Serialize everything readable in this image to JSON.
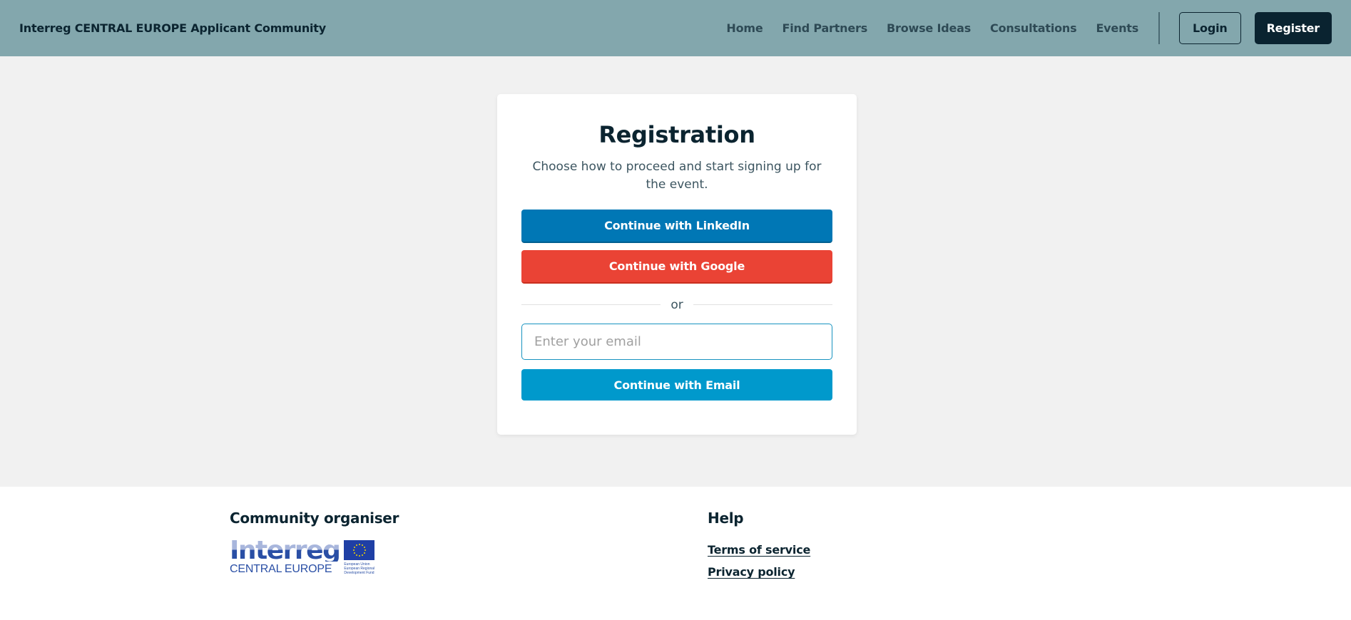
{
  "header": {
    "brand": "Interreg CENTRAL EUROPE Applicant Community",
    "nav": [
      {
        "label": "Home"
      },
      {
        "label": "Find Partners"
      },
      {
        "label": "Browse Ideas"
      },
      {
        "label": "Consultations"
      },
      {
        "label": "Events"
      }
    ],
    "login_label": "Login",
    "register_label": "Register"
  },
  "registration": {
    "title": "Registration",
    "subtitle": "Choose how to proceed and start signing up for the event.",
    "linkedin_label": "Continue with LinkedIn",
    "google_label": "Continue with Google",
    "divider_label": "or",
    "email_value": "",
    "email_placeholder": "Enter your email",
    "email_label": "Continue with Email"
  },
  "footer": {
    "organiser_heading": "Community organiser",
    "logo": {
      "word": "Interreg",
      "sub": "CENTRAL EUROPE",
      "eu_lines": [
        "European Union",
        "European Regional",
        "Development Fund"
      ],
      "icon": "eu-flag-icon"
    },
    "help_heading": "Help",
    "links": [
      {
        "label": "Terms of service"
      },
      {
        "label": "Privacy policy"
      }
    ]
  },
  "colors": {
    "header_bg": "#83a7ad",
    "page_bg": "#f1f1f1",
    "linkedin": "#0077b5",
    "google": "#ea4335",
    "email_button": "#0099cc",
    "register_bg": "#0a2330"
  }
}
